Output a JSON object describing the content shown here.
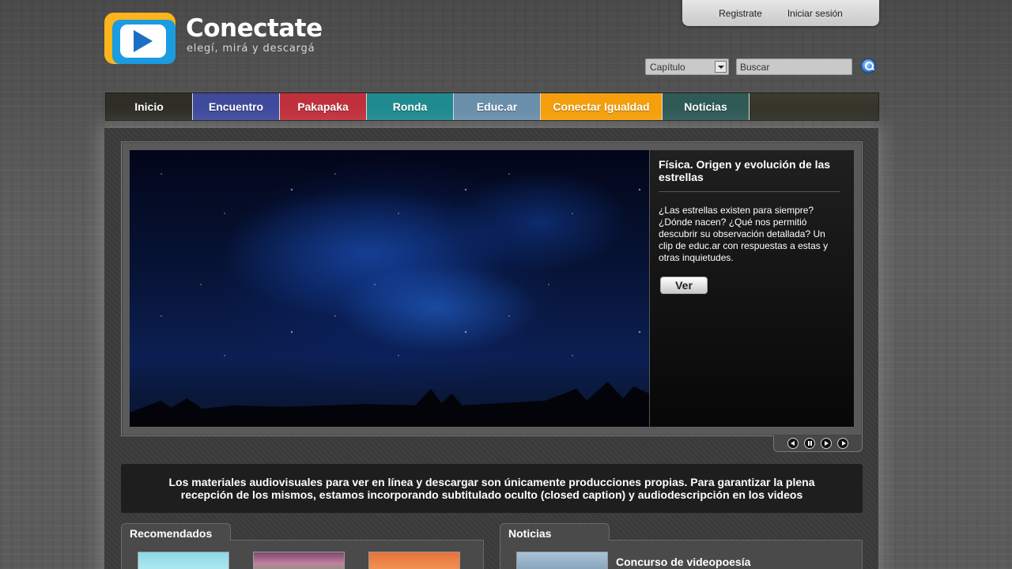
{
  "header": {
    "logo_title": "Conectate",
    "logo_tagline": "elegí, mirá y descargá",
    "register_label": "Registrate",
    "login_label": "Iniciar sesión",
    "search": {
      "category_selected": "Capítulo",
      "placeholder": "Buscar"
    }
  },
  "nav": {
    "items": [
      {
        "label": "Inicio",
        "color": "#2e2e26"
      },
      {
        "label": "Encuentro",
        "color": "#3f4a9c"
      },
      {
        "label": "Pakapaka",
        "color": "#c0303c"
      },
      {
        "label": "Ronda",
        "color": "#1f8a8f"
      },
      {
        "label": "Educ.ar",
        "color": "#6a8fab"
      },
      {
        "label": "Conectar Igualdad",
        "color": "#f59f0c"
      },
      {
        "label": "Noticias",
        "color": "#2f5a56"
      }
    ]
  },
  "featured": {
    "title": "Física. Origen y evolución de las estrellas",
    "description": "¿Las estrellas existen para siempre? ¿Dónde nacen? ¿Qué nos permitió descubrir su observación detallada? Un clip de educ.ar con respuestas a estas y otras inquietudes.",
    "button_label": "Ver"
  },
  "notice": {
    "text": "Los materiales audiovisuales para ver en línea y descargar son únicamente producciones propias. Para garantizar la plena recepción de los mismos, estamos incorporando subtitulado oculto (closed caption) y audiodescripción en los videos"
  },
  "recommended": {
    "tab_label": "Recomendados"
  },
  "news": {
    "tab_label": "Noticias",
    "headline": "Concurso de videopoesía"
  }
}
